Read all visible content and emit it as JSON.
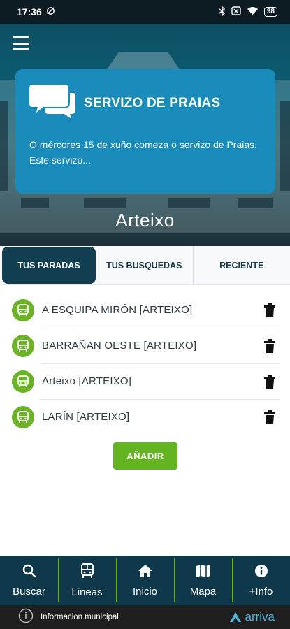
{
  "status_bar": {
    "time": "17:36",
    "battery": "98"
  },
  "news": {
    "title": "SERVIZO DE PRAIAS",
    "body": "O mércores 15 de xuño comeza o servizo de Praias. Este servizo..."
  },
  "brand": "Arteixo",
  "tabs": [
    {
      "label": "TUS PARADAS"
    },
    {
      "label": "TUS BUSQUEDAS"
    },
    {
      "label": "RECIENTE"
    }
  ],
  "stops": [
    {
      "name": "A ESQUIPA MIRÓN [ARTEIXO]"
    },
    {
      "name": "BARRAÑAN OESTE [ARTEIXO]"
    },
    {
      "name": "Arteixo [ARTEIXO]"
    },
    {
      "name": "LARÍN [ARTEIXO]"
    }
  ],
  "add_button": "AÑADIR",
  "nav": [
    {
      "label": "Buscar",
      "icon": "search-icon"
    },
    {
      "label": "Lineas",
      "icon": "bus-icon"
    },
    {
      "label": "Inicio",
      "icon": "home-icon"
    },
    {
      "label": "Mapa",
      "icon": "map-icon"
    },
    {
      "label": "+Info",
      "icon": "info-icon"
    }
  ],
  "footer": {
    "text": "Informacion municipal",
    "logo": "arriva"
  },
  "colors": {
    "accent": "#63b420",
    "primary": "#10384b",
    "card": "#1a8cbb"
  }
}
